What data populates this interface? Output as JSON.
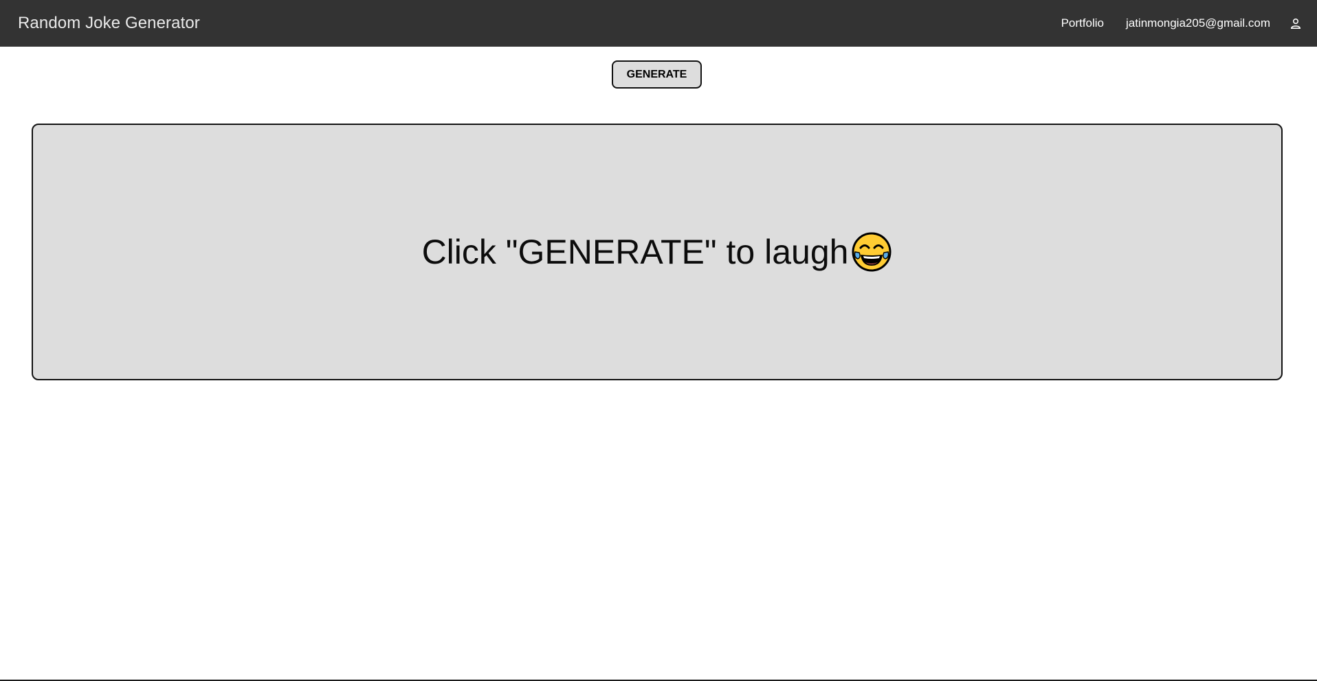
{
  "navbar": {
    "brand": "Random Joke Generator",
    "links": {
      "portfolio": "Portfolio",
      "email": "jatinmongia205@gmail.com"
    },
    "user_icon": "user-icon"
  },
  "main": {
    "generate_label": "GENERATE",
    "joke_text": "Click \"GENERATE\" to laugh",
    "emoji_icon": "face-with-tears-of-joy-icon"
  },
  "colors": {
    "navbar_bg": "#333333",
    "card_bg": "#dddddd",
    "border": "#111111",
    "emoji_face": "#FFCC33",
    "emoji_tears": "#5AAEE8"
  }
}
